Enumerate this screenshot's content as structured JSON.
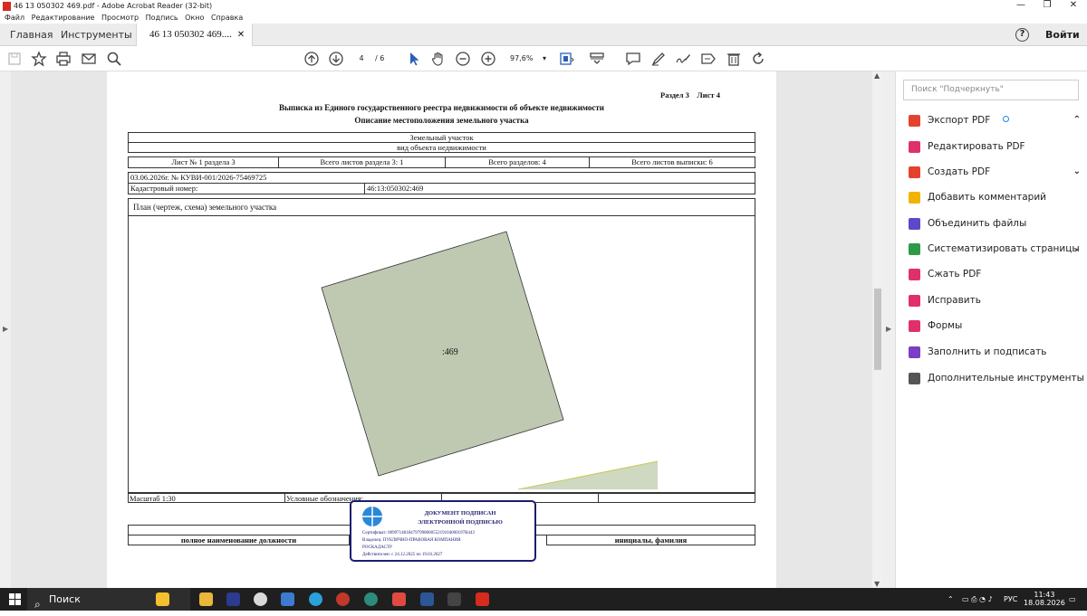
{
  "window": {
    "title": "46 13 050302 469.pdf - Adobe Acrobat Reader (32-bit)",
    "min": "—",
    "max": "❐",
    "close": "✕"
  },
  "menu": [
    "Файл",
    "Редактирование",
    "Просмотр",
    "Подпись",
    "Окно",
    "Справка"
  ],
  "tabs": {
    "home": "Главная",
    "tools": "Инструменты",
    "doc": "46 13 050302 469....",
    "close": "✕"
  },
  "header": {
    "help": "?",
    "signin": "Войти"
  },
  "toolbar": {
    "page_current": "4",
    "page_total": "/ 6",
    "zoom": "97,6%",
    "zoom_caret": "▾"
  },
  "document": {
    "section_label": "Раздел 3    Лист 4",
    "title": "Выписка из Единого государственного реестра недвижимости об объекте недвижимости",
    "subtitle": "Описание местоположения земельного участка",
    "object_type": "Земельный участок",
    "object_type_caption": "вид объекта недвижимости",
    "sheet_no": "Лист № 1 раздела 3",
    "sheets_in_section": "Всего листов раздела 3: 1",
    "total_sections": "Всего разделов: 4",
    "total_sheets": "Всего листов выписки: 6",
    "date_ref": "03.06.2026г. № КУВИ-001/2026-75469725",
    "cadastral_label": "Кадастровый номер:",
    "cadastral_value": "46:13:050302:469",
    "plan_label": "План (чертеж, схема) земельного участка",
    "parcel_label": ":469",
    "scale_label": "Масштаб 1:30",
    "legend_label": "Условные обозначения:",
    "position_caption": "полное наименование должности",
    "name_caption": "инициалы, фамилия",
    "parcel_fill": "#bfc9b2",
    "neighbor_fill": "#cfd8c1"
  },
  "stamp": {
    "line1": "ДОКУМЕНТ ПОДПИСАН",
    "line2": "ЭЛЕКТРОННОЙ ПОДПИСЬЮ",
    "cert": "Сертификат: 0099714818479799800055219104000197B443",
    "owner": "Владелец: ПУБЛИЧНО-ПРАВОВАЯ КОМПАНИЯ",
    "owner2": "РОСКАДАСТР",
    "valid": "Действителен: с 24.12.2025 по 19.03.2027",
    "color": "#1b1d6e"
  },
  "right_panel": {
    "search_placeholder": "Поиск \"Подчеркнуть\"",
    "tools": [
      {
        "label": "Экспорт PDF",
        "icon": "export-pdf-icon",
        "color": "#e3422f"
      },
      {
        "label": "Редактировать PDF",
        "icon": "edit-pdf-icon",
        "color": "#e0306b"
      },
      {
        "label": "Создать PDF",
        "icon": "create-pdf-icon",
        "color": "#e3422f"
      },
      {
        "label": "Добавить комментарий",
        "icon": "comment-icon",
        "color": "#f0b400"
      },
      {
        "label": "Объединить файлы",
        "icon": "combine-files-icon",
        "color": "#5c49c7"
      },
      {
        "label": "Систематизировать страницы",
        "icon": "organize-pages-icon",
        "color": "#2e9a45"
      },
      {
        "label": "Сжать PDF",
        "icon": "compress-pdf-icon",
        "color": "#e0306b"
      },
      {
        "label": "Исправить",
        "icon": "redact-icon",
        "color": "#e0306b"
      },
      {
        "label": "Формы",
        "icon": "forms-icon",
        "color": "#e0306b"
      },
      {
        "label": "Заполнить и подписать",
        "icon": "fill-sign-icon",
        "color": "#7a3fc4"
      },
      {
        "label": "Дополнительные инструменты",
        "icon": "more-tools-icon",
        "color": "#555555"
      }
    ]
  },
  "taskbar": {
    "search": "Поиск",
    "lang": "РУС",
    "time": "11:43",
    "date": "18.08.2026"
  }
}
